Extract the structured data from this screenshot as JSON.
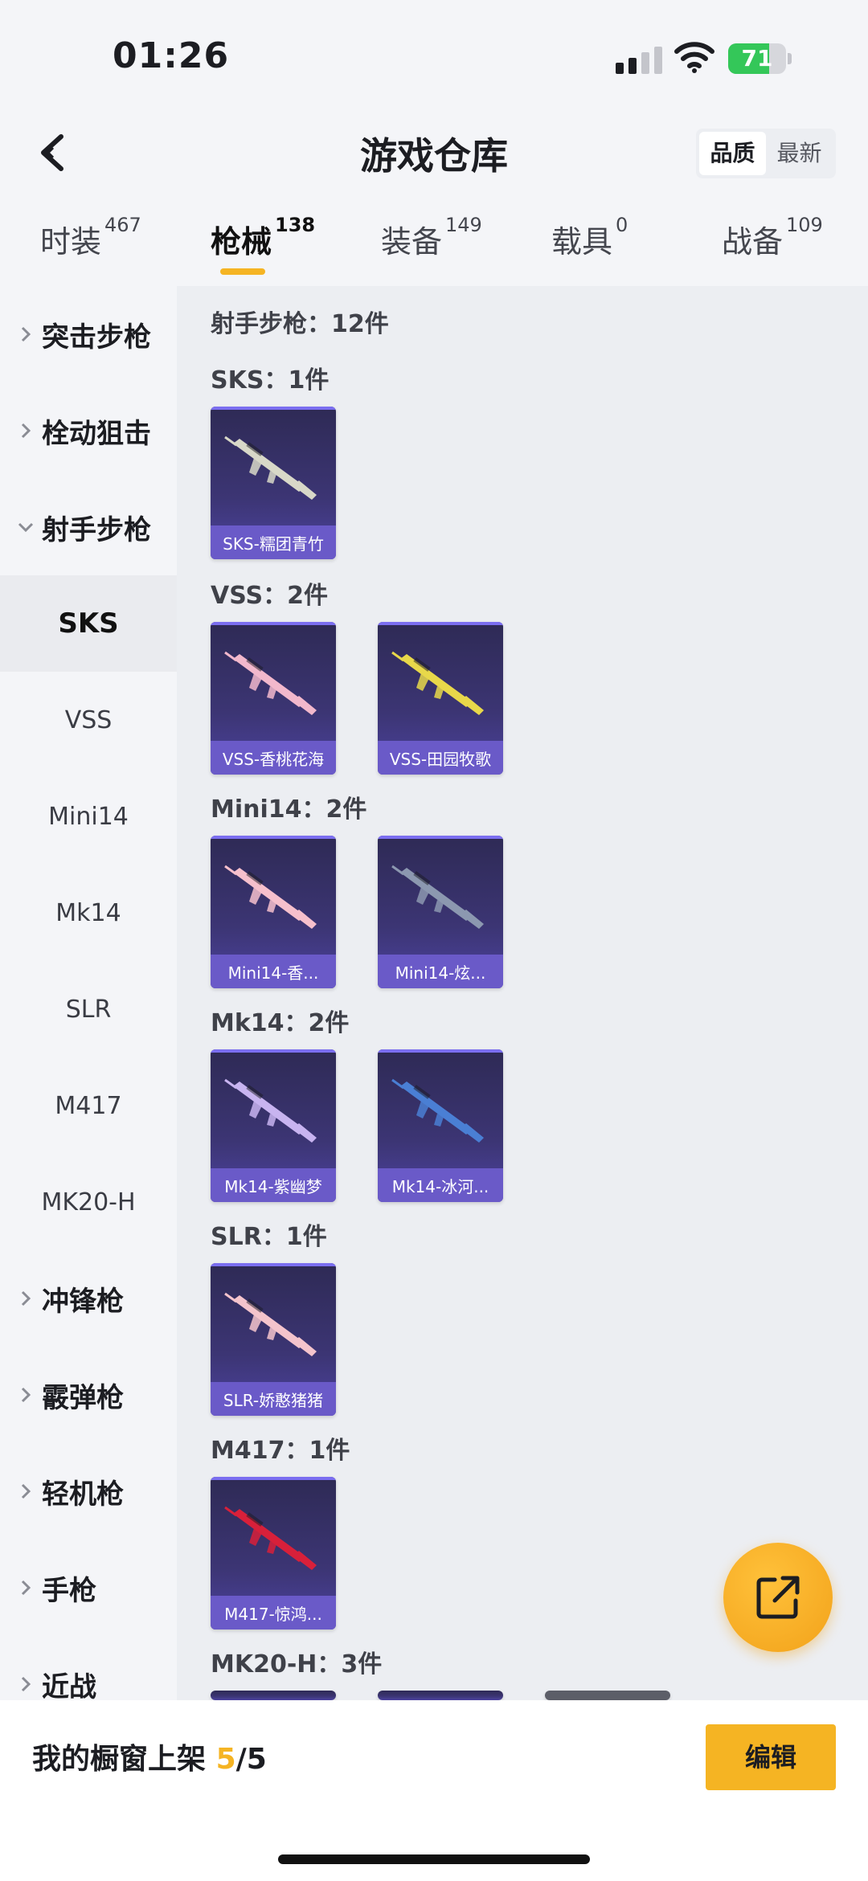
{
  "status": {
    "time": "01:26",
    "battery": "71",
    "battery_level": 0.71
  },
  "header": {
    "title": "游戏仓库",
    "sort_quality": "品质",
    "sort_newest": "最新"
  },
  "tabs": [
    {
      "label": "时装",
      "count": "467"
    },
    {
      "label": "枪械",
      "count": "138"
    },
    {
      "label": "装备",
      "count": "149"
    },
    {
      "label": "载具",
      "count": "0"
    },
    {
      "label": "战备",
      "count": "109"
    }
  ],
  "sidebar": {
    "categories_top": [
      "突击步枪",
      "栓动狙击",
      "射手步枪"
    ],
    "subitems": [
      "SKS",
      "VSS",
      "Mini14",
      "Mk14",
      "SLR",
      "M417",
      "MK20-H"
    ],
    "categories_bottom": [
      "冲锋枪",
      "霰弹枪",
      "轻机枪",
      "手枪",
      "近战"
    ]
  },
  "main": {
    "summary": "射手步枪：12件",
    "sections": [
      {
        "title": "SKS：1件",
        "items": [
          "SKS-糯团青竹"
        ]
      },
      {
        "title": "VSS：2件",
        "items": [
          "VSS-香桃花海",
          "VSS-田园牧歌"
        ]
      },
      {
        "title": "Mini14：2件",
        "items": [
          "Mini14-香...",
          "Mini14-炫..."
        ]
      },
      {
        "title": "Mk14：2件",
        "items": [
          "Mk14-紫幽梦",
          "Mk14-冰河..."
        ]
      },
      {
        "title": "SLR：1件",
        "items": [
          "SLR-娇憨猪猪"
        ]
      },
      {
        "title": "M417：1件",
        "items": [
          "M417-惊鸿..."
        ]
      },
      {
        "title": "MK20-H：3件",
        "items": []
      }
    ]
  },
  "gun_colors": [
    "#d8d8c8",
    "#f2b8cc",
    "#e8d84a",
    "#f6c0cc",
    "#8c98b0",
    "#c8b4f0",
    "#4a7fd4",
    "#f4c4cc",
    "#d8203a"
  ],
  "bottom": {
    "label": "我的橱窗上架",
    "current": "5",
    "total": "/5",
    "edit": "编辑"
  }
}
